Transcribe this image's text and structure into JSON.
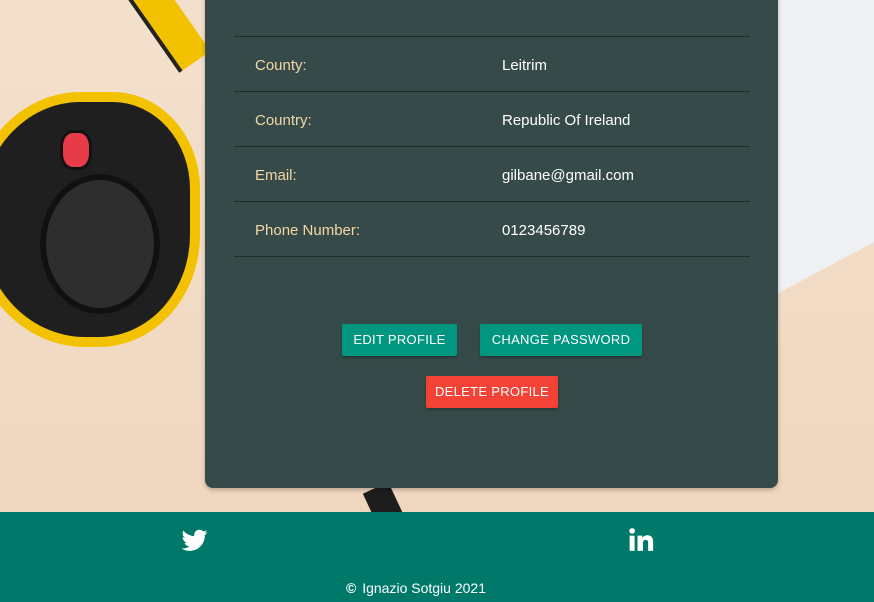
{
  "profile": {
    "rows": [
      {
        "label": "County:",
        "value": "Leitrim"
      },
      {
        "label": "Country:",
        "value": "Republic Of Ireland"
      },
      {
        "label": "Email:",
        "value": "gilbane@gmail.com"
      },
      {
        "label": "Phone Number:",
        "value": "0123456789"
      }
    ]
  },
  "actions": {
    "edit_label": "EDIT PROFILE",
    "change_password_label": "CHANGE PASSWORD",
    "delete_label": "DELETE PROFILE"
  },
  "footer": {
    "social": [
      "twitter-icon",
      "linkedin-icon"
    ],
    "copyright_symbol": "©",
    "copyright_text": "Ignazio Sotgiu 2021"
  },
  "colors": {
    "card_bg": "#364b49",
    "label_color": "#f2d7a6",
    "primary_button": "#00967f",
    "danger_button": "#f44336",
    "footer_bg": "#00796b"
  }
}
